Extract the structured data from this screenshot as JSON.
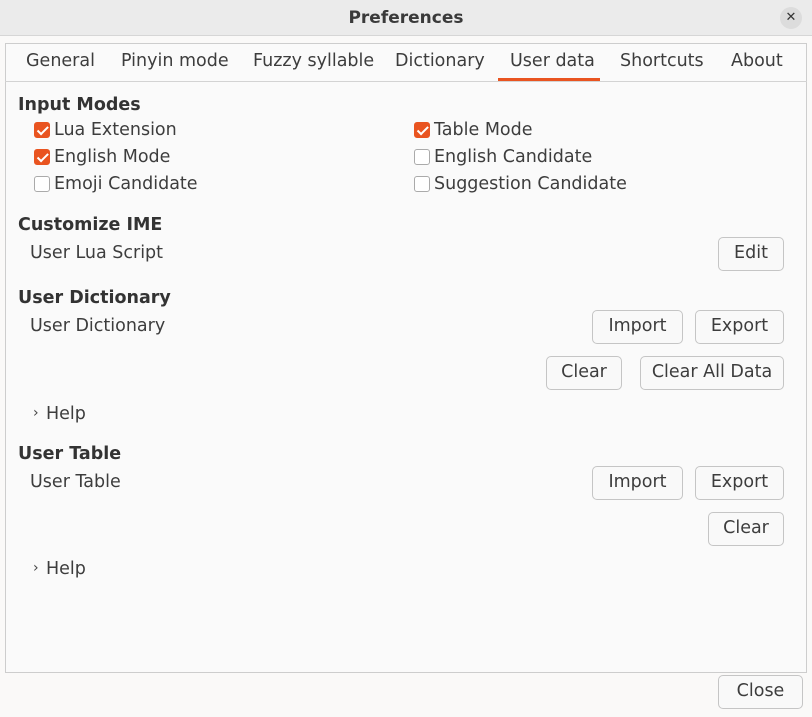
{
  "window": {
    "title": "Preferences",
    "close_glyph": "✕"
  },
  "tabs": [
    "General",
    "Pinyin mode",
    "Fuzzy syllable",
    "Dictionary",
    "User data",
    "Shortcuts",
    "About"
  ],
  "active_tab": "User data",
  "accent_color": "#e95420",
  "input_modes": {
    "heading": "Input Modes",
    "options": [
      {
        "label": "Lua Extension",
        "checked": true
      },
      {
        "label": "Table Mode",
        "checked": true
      },
      {
        "label": "English Mode",
        "checked": true
      },
      {
        "label": "English Candidate",
        "checked": false
      },
      {
        "label": "Emoji Candidate",
        "checked": false
      },
      {
        "label": "Suggestion Candidate",
        "checked": false
      }
    ]
  },
  "customize_ime": {
    "heading": "Customize IME",
    "item_label": "User Lua Script",
    "edit_label": "Edit"
  },
  "user_dictionary": {
    "heading": "User Dictionary",
    "item_label": "User Dictionary",
    "import_label": "Import",
    "export_label": "Export",
    "clear_label": "Clear",
    "clear_all_label": "Clear All Data",
    "help_label": "Help"
  },
  "user_table": {
    "heading": "User Table",
    "item_label": "User Table",
    "import_label": "Import",
    "export_label": "Export",
    "clear_label": "Clear",
    "help_label": "Help"
  },
  "footer": {
    "close_label": "Close"
  },
  "icons": {
    "chevron": "›"
  }
}
